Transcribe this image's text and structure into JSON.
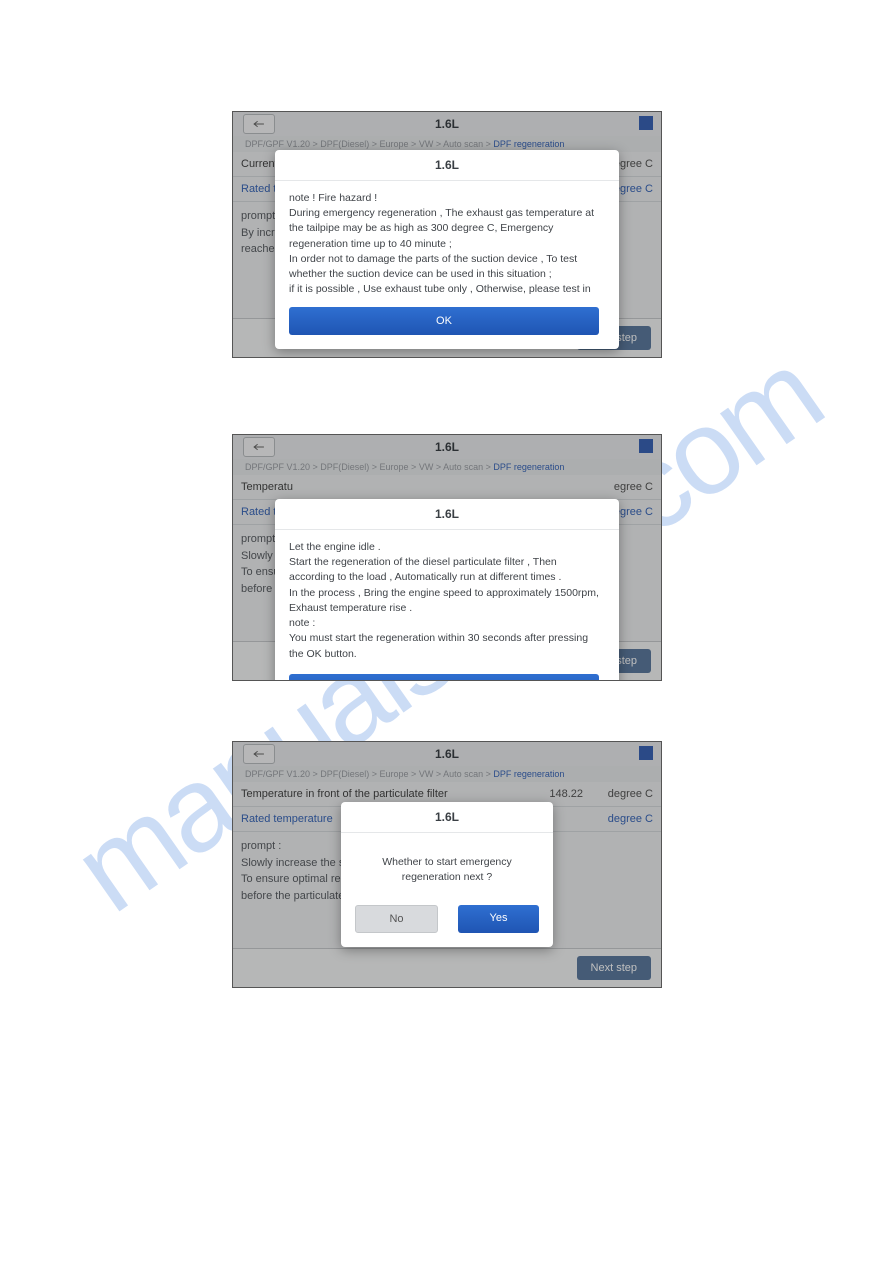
{
  "screens": [
    {
      "title": "1.6L",
      "crumb_prefix": "DPF/GPF V1.20 > DPF(Diesel) > Europe > VW > Auto scan > ",
      "crumb_hl": "DPF regeneration",
      "row1": {
        "label": "Current co",
        "value": "",
        "unit": "degree C"
      },
      "row2": {
        "label": "Rated tem",
        "value": "",
        "unit": "degree C"
      },
      "prompt": "prompt :\nBy increas\nreached fa",
      "next": "Next step",
      "dialog": {
        "title": "1.6L",
        "body": "note ! Fire hazard !\nDuring emergency regeneration , The exhaust gas temperature at the tailpipe may be as high as 300 degree C, Emergency regeneration time up to 40 minute ;\nIn order not to damage the parts of the suction device , To test whether the suction device can be used in this situation ;\nif it is possible , Use exhaust tube only , Otherwise, please test in the open space ;\nVehicles must be parked on high temperature resistant ground during emergency regeneration ;\nThere must be no flammable substances around or under the vehicle , E.g. hay , wood",
        "ok": "OK"
      }
    },
    {
      "title": "1.6L",
      "crumb_prefix": "DPF/GPF V1.20 > DPF(Diesel) > Europe > VW > Auto scan > ",
      "crumb_hl": "DPF regeneration",
      "row1": {
        "label": "Temperatu",
        "value": "",
        "unit": "egree C"
      },
      "row2": {
        "label": "Rated tem",
        "value": "",
        "unit": "egree C"
      },
      "prompt": "prompt :\nSlowly inc\nTo ensure\nbefore the",
      "next": "Next step",
      "dialog": {
        "title": "1.6L",
        "body": "Let the engine idle .\nStart the regeneration of the diesel particulate filter , Then according to the load , Automatically run at different times .\nIn the process , Bring the engine speed to approximately 1500rpm, Exhaust temperature rise .\nnote :\nYou must start the regeneration within 30 seconds after pressing the OK button.",
        "ok": "OK"
      }
    },
    {
      "title": "1.6L",
      "crumb_prefix": "DPF/GPF V1.20 > DPF(Diesel) > Europe > VW > Auto scan > ",
      "crumb_hl": "DPF regeneration",
      "row1": {
        "label": "Temperature in front of the particulate filter",
        "value": "148.22",
        "unit": "degree C"
      },
      "row2": {
        "label": "Rated temperature",
        "value": "",
        "unit": "degree C"
      },
      "prompt": "prompt :\nSlowly increase the speed t\nTo ensure optimal regenera\nbefore the particulate filter",
      "next": "Next step",
      "dialog": {
        "title": "1.6L",
        "body": "Whether to start emergency regeneration next ?",
        "no": "No",
        "yes": "Yes"
      }
    }
  ],
  "watermark": "manualshive.com"
}
